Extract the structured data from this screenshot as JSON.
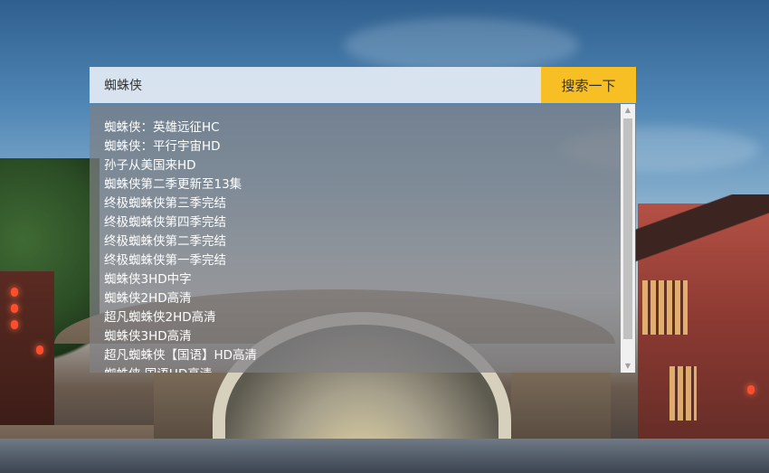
{
  "search": {
    "value": "蜘蛛侠",
    "button_label": "搜索一下"
  },
  "suggestions": [
    "蜘蛛侠：英雄远征HC",
    "蜘蛛侠：平行宇宙HD",
    "孙子从美国来HD",
    "蜘蛛侠第二季更新至13集",
    "终极蜘蛛侠第三季完结",
    "终极蜘蛛侠第四季完结",
    "终极蜘蛛侠第二季完结",
    "终极蜘蛛侠第一季完结",
    "蜘蛛侠3HD中字",
    "蜘蛛侠2HD高清",
    "超凡蜘蛛侠2HD高清",
    "蜘蛛侠3HD高清",
    "超凡蜘蛛侠【国语】HD高清",
    "蜘蛛侠 国语HD高清"
  ],
  "colors": {
    "button": "#f7bf24",
    "dropdown": "rgba(128,128,132,0.72)"
  },
  "icons": {
    "scroll_up": "triangle-up",
    "scroll_down": "triangle-down"
  }
}
